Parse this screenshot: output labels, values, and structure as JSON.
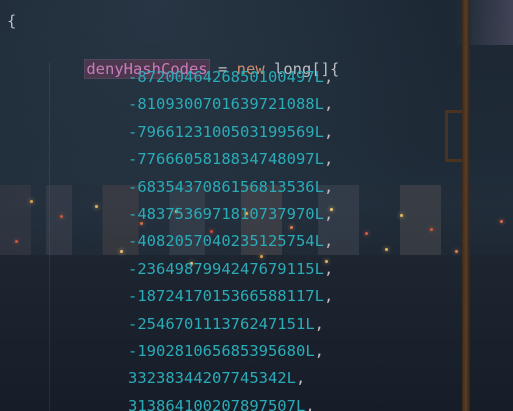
{
  "editor": {
    "open_brace": "{",
    "declaration": {
      "identifier": "denyHashCodes",
      "operator": " = ",
      "keyword": "new",
      "type": " long[]{"
    },
    "values": [
      "-8720046426850100497",
      "-8109300701639721088",
      "-7966123100503199569",
      "-7766605818834748097",
      "-6835437086156813536",
      "-4837536971810737970",
      "-4082057040235125754",
      "-2364987994247679115",
      "-1872417015366588117",
      "-254670111376247151",
      "-190281065685395680",
      "33238344207745342",
      "313864100207897507"
    ],
    "value_suffix": "L",
    "separator": ","
  },
  "colors": {
    "identifier": "#c77dbb",
    "keyword": "#cf8e6d",
    "number": "#2aacb8",
    "text": "#bcbec4"
  }
}
